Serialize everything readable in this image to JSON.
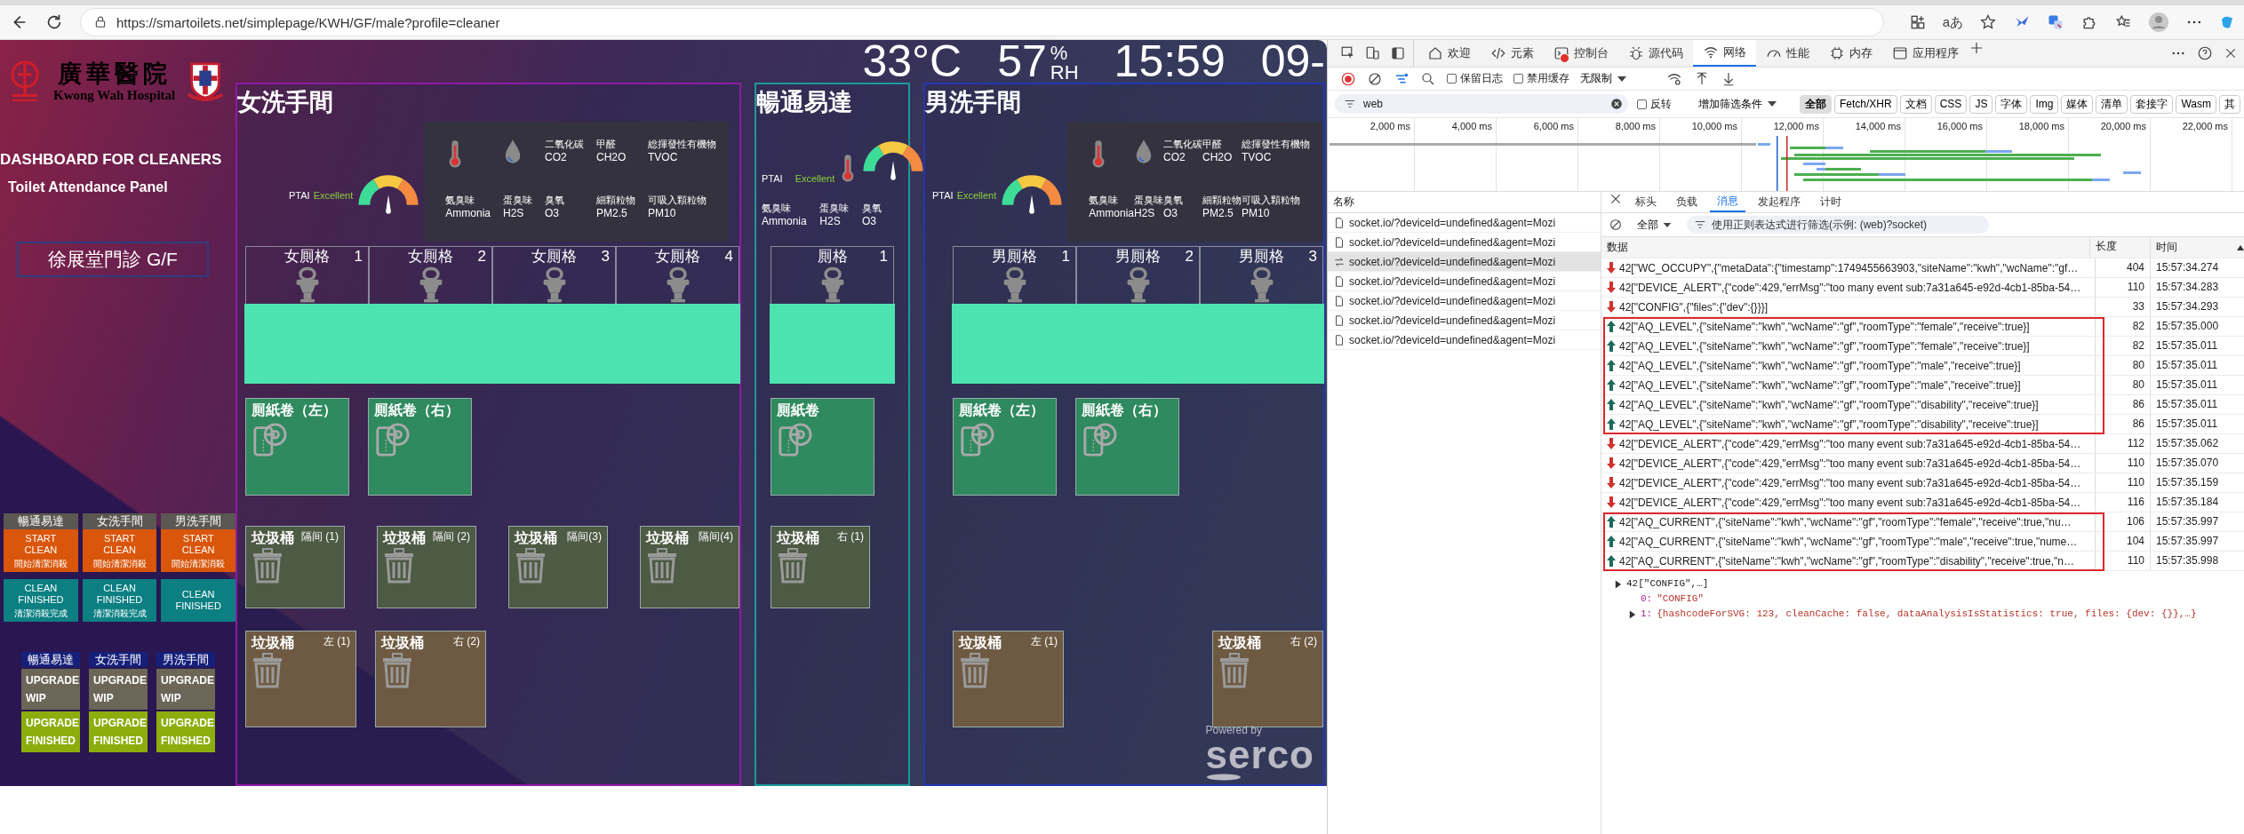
{
  "browser": {
    "url": "https://smartoilets.net/simplepage/KWH/GF/male?profile=cleaner",
    "read_aloud": "aあ"
  },
  "dashboard": {
    "hospital": {
      "name_zh": "廣華醫院",
      "name_en": "Kwong Wah Hospital"
    },
    "title": "DASHBOARD FOR CLEANERS",
    "subtitle": "Toilet Attendance Panel",
    "location": "徐展堂門診 G/F",
    "clean_panels": [
      {
        "area": "暢通易達",
        "start_label": "START CLEAN",
        "start_sublabel": "開始清潔消殺",
        "finish_label": "CLEAN FINISHED",
        "finish_sublabel": "清潔消殺完成"
      },
      {
        "area": "女洗手間",
        "start_label": "START CLEAN",
        "start_sublabel": "開始清潔消殺",
        "finish_label": "CLEAN FINISHED",
        "finish_sublabel": "清潔消殺完成"
      },
      {
        "area": "男洗手間",
        "start_label": "START CLEAN",
        "start_sublabel": "開始清潔消殺",
        "finish_label": "CLEAN FINISHED"
      }
    ],
    "upgrade_panels": [
      {
        "area": "暢通易達",
        "wip_label": "UPGRADE WIP",
        "finished_label": "UPGRADE FINISHED"
      },
      {
        "area": "女洗手間",
        "wip_label": "UPGRADE WIP",
        "finished_label": "UPGRADE FINISHED"
      },
      {
        "area": "男洗手間",
        "wip_label": "UPGRADE WIP",
        "finished_label": "UPGRADE FINISHED"
      }
    ],
    "conditions": {
      "temperature": "33°C",
      "humidity": "57",
      "humidity_unit_top": "%",
      "humidity_unit_bottom": "RH",
      "time": "15:59",
      "date": "09-"
    },
    "sections": [
      {
        "title": "女洗手間",
        "kind": "wide",
        "color": "#8e1aa6",
        "ptai_label": "PTAI",
        "ptai_value": "Excellent",
        "gauge": {
          "level": 0.5
        },
        "sensors": [
          {
            "zh": "二氧化碳",
            "en": "CO2"
          },
          {
            "zh": "甲醛",
            "en": "CH2O"
          },
          {
            "zh": "総揮發性有機物",
            "en": "TVOC"
          },
          {
            "zh": "氨臭味",
            "en": "Ammonia"
          },
          {
            "zh": "蛋臭味",
            "en": "H2S"
          },
          {
            "zh": "臭氧",
            "en": "O3"
          },
          {
            "zh": "細顆粒物",
            "en": "PM2.5"
          },
          {
            "zh": "可吸入顆粒物",
            "en": "PM10"
          }
        ],
        "stalls": [
          {
            "label": "女厠格",
            "number": "1",
            "occupied": false
          },
          {
            "label": "女厠格",
            "number": "2",
            "occupied": false
          },
          {
            "label": "女厠格",
            "number": "3",
            "occupied": false
          },
          {
            "label": "女厠格",
            "number": "4",
            "occupied": false
          }
        ],
        "paper": [
          {
            "label": "厠紙卷（左）"
          },
          {
            "label": "厠紙卷（右）"
          }
        ],
        "stall_bins": [
          {
            "label": "垃圾桶",
            "position": "隔间 (1)"
          },
          {
            "label": "垃圾桶",
            "position": "隔间 (2)"
          },
          {
            "label": "垃圾桶",
            "position": "隔间(3)"
          },
          {
            "label": "垃圾桶",
            "position": "隔间(4)"
          }
        ],
        "floor_bins": [
          {
            "label": "垃圾桶",
            "position": "左 (1)"
          },
          {
            "label": "垃圾桶",
            "position": "右 (2)"
          }
        ]
      },
      {
        "title": "暢通易達",
        "kind": "compact",
        "color": "#1a9a9a",
        "ptai_label": "PTAI",
        "ptai_value": "Excellent",
        "gauge": {
          "level": 0.5
        },
        "sensors": [
          {
            "zh": "氨臭味",
            "en": "Ammonia"
          },
          {
            "zh": "蛋臭味",
            "en": "H2S"
          },
          {
            "zh": "臭氧",
            "en": "O3"
          }
        ],
        "stalls": [
          {
            "label": "厠格",
            "number": "1",
            "occupied": false
          }
        ],
        "paper": [
          {
            "label": "厠紙卷"
          }
        ],
        "stall_bins": [
          {
            "label": "垃圾桶",
            "position": "右 (1)"
          }
        ]
      },
      {
        "title": "男洗手間",
        "kind": "wide",
        "color": "#2436b0",
        "ptai_label": "PTAI",
        "ptai_value": "Excellent",
        "gauge": {
          "level": 0.5
        },
        "sensors": [
          {
            "zh": "二氧化碳",
            "en": "CO2"
          },
          {
            "zh": "甲醛",
            "en": "CH2O"
          },
          {
            "zh": "総揮發性有機物",
            "en": "TVOC"
          },
          {
            "zh": "氨臭味",
            "en": "Ammonia"
          },
          {
            "zh": "蛋臭味",
            "en": "H2S"
          },
          {
            "zh": "臭氧",
            "en": "O3"
          },
          {
            "zh": "細顆粒物",
            "en": "PM2.5"
          },
          {
            "zh": "可吸入顆粒物",
            "en": "PM10"
          }
        ],
        "stalls": [
          {
            "label": "男厠格",
            "number": "1",
            "occupied": false
          },
          {
            "label": "男厠格",
            "number": "2",
            "occupied": false
          },
          {
            "label": "男厠格",
            "number": "3",
            "occupied": false
          }
        ],
        "paper": [
          {
            "label": "厠紙卷（左）"
          },
          {
            "label": "厠紙卷（右）"
          }
        ],
        "floor_bins": [
          {
            "label": "垃圾桶",
            "position": "左 (1)"
          },
          {
            "label": "垃圾桶",
            "position": "右 (2)"
          }
        ]
      }
    ],
    "powered_by": "Powered by",
    "brand": "serco"
  },
  "devtools": {
    "tabs": [
      {
        "label": "欢迎",
        "selected": false,
        "error": false
      },
      {
        "label": "元素",
        "selected": false,
        "error": false
      },
      {
        "label": "控制台",
        "selected": false,
        "error": true
      },
      {
        "label": "源代码",
        "selected": false,
        "error": false
      },
      {
        "label": "网络",
        "selected": true,
        "error": false
      },
      {
        "label": "性能",
        "selected": false,
        "error": false
      },
      {
        "label": "内存",
        "selected": false,
        "error": false
      },
      {
        "label": "应用程序",
        "selected": false,
        "error": false
      }
    ],
    "options": [
      {
        "label": "保留日志",
        "checked": false
      },
      {
        "label": "禁用缓存",
        "checked": false
      }
    ],
    "throttling": "无限制",
    "filter": {
      "value": "web",
      "invert": {
        "label": "反转",
        "checked": false
      },
      "more_filters": "增加筛选条件",
      "types": [
        {
          "label": "全部",
          "selected": true
        },
        {
          "label": "Fetch/XHR",
          "selected": false
        },
        {
          "label": "文档",
          "selected": false
        },
        {
          "label": "CSS",
          "selected": false
        },
        {
          "label": "JS",
          "selected": false
        },
        {
          "label": "字体",
          "selected": false
        },
        {
          "label": "Img",
          "selected": false
        },
        {
          "label": "媒体",
          "selected": false
        },
        {
          "label": "清单",
          "selected": false
        },
        {
          "label": "套接字",
          "selected": false
        },
        {
          "label": "Wasm",
          "selected": false
        },
        {
          "label": "其",
          "selected": false
        }
      ]
    },
    "timeline": {
      "ticks": [
        "2,000 ms",
        "4,000 ms",
        "6,000 ms",
        "8,000 ms",
        "10,000 ms",
        "12,000 ms",
        "14,000 ms",
        "16,000 ms",
        "18,000 ms",
        "20,000 ms",
        "22,000 ms"
      ]
    },
    "requests": {
      "header": "名称",
      "items": [
        {
          "name": "socket.io/?deviceId=undefined&agent=Mozi",
          "kind": "document",
          "selected": false
        },
        {
          "name": "socket.io/?deviceId=undefined&agent=Mozi",
          "kind": "document",
          "selected": false
        },
        {
          "name": "socket.io/?deviceId=undefined&agent=Mozi",
          "kind": "websocket",
          "selected": true
        },
        {
          "name": "socket.io/?deviceId=undefined&agent=Mozi",
          "kind": "document",
          "selected": false
        },
        {
          "name": "socket.io/?deviceId=undefined&agent=Mozi",
          "kind": "document",
          "selected": false
        },
        {
          "name": "socket.io/?deviceId=undefined&agent=Mozi",
          "kind": "document",
          "selected": false
        },
        {
          "name": "socket.io/?deviceId=undefined&agent=Mozi",
          "kind": "document",
          "selected": false
        }
      ]
    },
    "detail_tabs": [
      {
        "label": "标头",
        "selected": false
      },
      {
        "label": "负载",
        "selected": false
      },
      {
        "label": "消息",
        "selected": true
      },
      {
        "label": "发起程序",
        "selected": false
      },
      {
        "label": "计时",
        "selected": false
      }
    ],
    "message_filter": {
      "type": "全部",
      "placeholder": "使用正则表达式进行筛选(示例: (web)?socket)"
    },
    "columns": [
      "数据",
      "长度",
      "时间"
    ],
    "message_groups": [
      {
        "highlighted": false,
        "messages": [
          {
            "kind": "received",
            "data": "42[\"WC_OCCUPY\",{\"metaData\":{\"timestamp\":1749455663903,\"siteName\":\"kwh\",\"wcName\":\"gf…",
            "length": "404",
            "time": "15:57:34.274"
          },
          {
            "kind": "received",
            "data": "42[\"DEVICE_ALERT\",{\"code\":429,\"errMsg\":\"too many event sub:7a31a645-e92d-4cb1-85ba-54…",
            "length": "110",
            "time": "15:57:34.283"
          },
          {
            "kind": "received",
            "data": "42[\"CONFIG\",{\"files\":{\"dev\":{}}}]",
            "length": "33",
            "time": "15:57:34.293"
          }
        ]
      },
      {
        "highlighted": true,
        "messages": [
          {
            "kind": "sent",
            "data": "42[\"AQ_LEVEL\",{\"siteName\":\"kwh\",\"wcName\":\"gf\",\"roomType\":\"female\",\"receive\":true}]",
            "length": "82",
            "time": "15:57:35.000"
          },
          {
            "kind": "sent",
            "data": "42[\"AQ_LEVEL\",{\"siteName\":\"kwh\",\"wcName\":\"gf\",\"roomType\":\"female\",\"receive\":true}]",
            "length": "82",
            "time": "15:57:35.011"
          },
          {
            "kind": "sent",
            "data": "42[\"AQ_LEVEL\",{\"siteName\":\"kwh\",\"wcName\":\"gf\",\"roomType\":\"male\",\"receive\":true}]",
            "length": "80",
            "time": "15:57:35.011"
          },
          {
            "kind": "sent",
            "data": "42[\"AQ_LEVEL\",{\"siteName\":\"kwh\",\"wcName\":\"gf\",\"roomType\":\"male\",\"receive\":true}]",
            "length": "80",
            "time": "15:57:35.011"
          },
          {
            "kind": "sent",
            "data": "42[\"AQ_LEVEL\",{\"siteName\":\"kwh\",\"wcName\":\"gf\",\"roomType\":\"disability\",\"receive\":true}]",
            "length": "86",
            "time": "15:57:35.011"
          },
          {
            "kind": "sent",
            "data": "42[\"AQ_LEVEL\",{\"siteName\":\"kwh\",\"wcName\":\"gf\",\"roomType\":\"disability\",\"receive\":true}]",
            "length": "86",
            "time": "15:57:35.011"
          }
        ]
      },
      {
        "highlighted": false,
        "messages": [
          {
            "kind": "received",
            "data": "42[\"DEVICE_ALERT\",{\"code\":429,\"errMsg\":\"too many event sub:7a31a645-e92d-4cb1-85ba-54…",
            "length": "112",
            "time": "15:57:35.062"
          },
          {
            "kind": "received",
            "data": "42[\"DEVICE_ALERT\",{\"code\":429,\"errMsg\":\"too many event sub:7a31a645-e92d-4cb1-85ba-54…",
            "length": "110",
            "time": "15:57:35.070"
          },
          {
            "kind": "received",
            "data": "42[\"DEVICE_ALERT\",{\"code\":429,\"errMsg\":\"too many event sub:7a31a645-e92d-4cb1-85ba-54…",
            "length": "110",
            "time": "15:57:35.159"
          },
          {
            "kind": "received",
            "data": "42[\"DEVICE_ALERT\",{\"code\":429,\"errMsg\":\"too many event sub:7a31a645-e92d-4cb1-85ba-54…",
            "length": "116",
            "time": "15:57:35.184"
          }
        ]
      },
      {
        "highlighted": true,
        "messages": [
          {
            "kind": "sent",
            "data": "42[\"AQ_CURRENT\",{\"siteName\":\"kwh\",\"wcName\":\"gf\",\"roomType\":\"female\",\"receive\":true,\"nu…",
            "length": "106",
            "time": "15:57:35.997"
          },
          {
            "kind": "sent",
            "data": "42[\"AQ_CURRENT\",{\"siteName\":\"kwh\",\"wcName\":\"gf\",\"roomType\":\"male\",\"receive\":true,\"nume…",
            "length": "104",
            "time": "15:57:35.997"
          },
          {
            "kind": "sent",
            "data": "42[\"AQ_CURRENT\",{\"siteName\":\"kwh\",\"wcName\":\"gf\",\"roomType\":\"disability\",\"receive\":true,\"n…",
            "length": "110",
            "time": "15:57:35.998"
          }
        ]
      }
    ],
    "detail": {
      "label": "42[\"CONFIG\",…]",
      "children": [
        {
          "key": "0:",
          "value": "\"CONFIG\"",
          "has_children": false
        },
        {
          "key": "1:",
          "value": "{hashcodeForSVG: 123, cleanCache: false, dataAnalysisIsStatistics: true, files: {dev: {}},…}",
          "has_children": true
        }
      ]
    }
  }
}
